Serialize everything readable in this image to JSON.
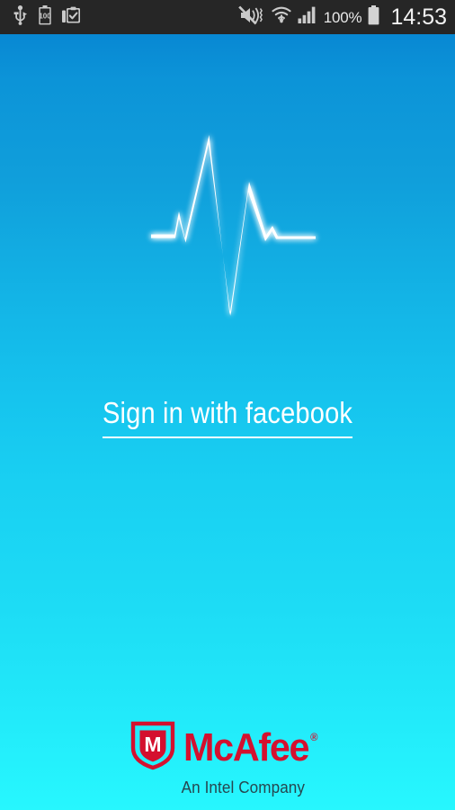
{
  "status_bar": {
    "background_color": "#262626",
    "left_icons": [
      {
        "name": "usb-icon",
        "label": "USB connected"
      },
      {
        "name": "battery-100-icon",
        "label": "100"
      },
      {
        "name": "clipboard-check-icon",
        "label": "Task complete"
      }
    ],
    "right_icons": [
      {
        "name": "mute-vibrate-icon",
        "label": "Sound off / vibrate"
      },
      {
        "name": "wifi-download-icon",
        "label": "Wi-Fi"
      },
      {
        "name": "signal-bars-icon",
        "label": "Mobile signal"
      },
      {
        "name": "battery-icon",
        "label": "Battery full"
      }
    ],
    "battery_percent": "100%",
    "clock": "14:53"
  },
  "background": {
    "gradient_top": "#0888d3",
    "gradient_mid": "#16c4ee",
    "gradient_bottom": "#27f7fe"
  },
  "logo": {
    "name": "pulse-waveform-logo",
    "color": "#ffffff",
    "description": "Heartbeat pulse waveform"
  },
  "main": {
    "sign_in_label": "Sign in with facebook"
  },
  "branding": {
    "shield_icon_name": "mcafee-shield-icon",
    "shield_letter": "M",
    "brand_name": "McAfee",
    "registered_mark": "®",
    "tagline": "An Intel Company",
    "brand_color": "#d4102e",
    "tagline_color": "#26464f"
  }
}
